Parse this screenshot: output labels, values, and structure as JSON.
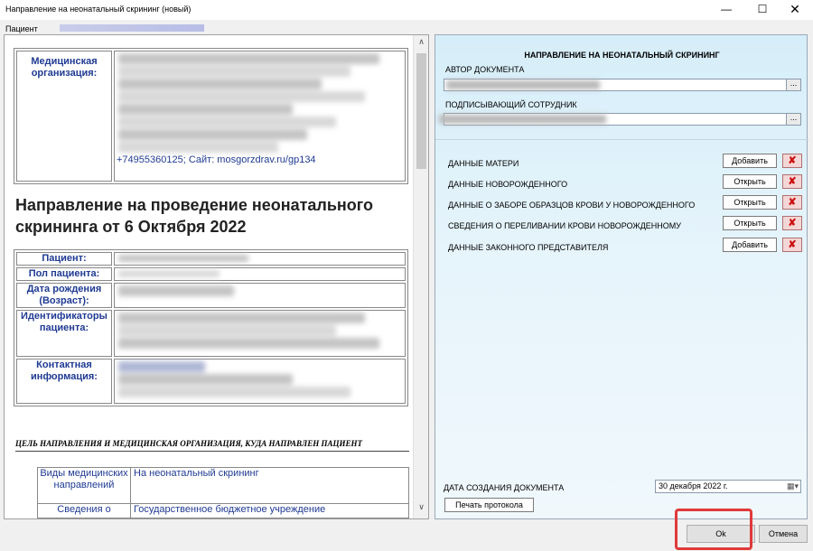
{
  "window": {
    "title": "Направление на неонатальный скрининг (новый)",
    "minimize": "—",
    "maximize": "☐",
    "close": "✕"
  },
  "patient_bar": {
    "label": "Пациент"
  },
  "document": {
    "med_org_label": "Медицинская организация:",
    "med_org_contact": "+74955360125; Сайт: mosgorzdrav.ru/gp134",
    "heading": "Направление на проведение неонатального скрининга от 6 Октября 2022",
    "patient_rows": [
      {
        "label": "Пациент:"
      },
      {
        "label": "Пол пациента:"
      },
      {
        "label": "Дата рождения (Возраст):"
      },
      {
        "label": "Идентификаторы пациента:"
      },
      {
        "label": "Контактная информация:"
      }
    ],
    "section_heading": "ЦЕЛЬ НАПРАВЛЕНИЯ И МЕДИЦИНСКАЯ ОРГАНИЗАЦИЯ, КУДА НАПРАВЛЕН ПАЦИЕНТ",
    "direction_rows": [
      {
        "key": "Виды медицинских направлений",
        "value": "На неонатальный скрининг"
      },
      {
        "key": "Сведения о",
        "value": "Государственное бюджетное учреждение"
      }
    ]
  },
  "form": {
    "title": "НАПРАВЛЕНИЕ НА НЕОНАТАЛЬНЫЙ СКРИНИНГ",
    "author_label": "АВТОР ДОКУМЕНТА",
    "signer_label": "ПОДПИСЫВАЮЩИЙ СОТРУДНИК",
    "lookup_button": "...",
    "sections": [
      {
        "label": "ДАННЫЕ МАТЕРИ",
        "button": "Добавить",
        "delete": "✘"
      },
      {
        "label": "ДАННЫЕ НОВОРОЖДЕННОГО",
        "button": "Открыть",
        "delete": "✘"
      },
      {
        "label": "ДАННЫЕ О ЗАБОРЕ ОБРАЗЦОВ КРОВИ У НОВОРОЖДЕННОГО",
        "button": "Открыть",
        "delete": "✘"
      },
      {
        "label": "СВЕДЕНИЯ О ПЕРЕЛИВАНИИ КРОВИ НОВОРОЖДЕННОМУ",
        "button": "Открыть",
        "delete": "✘"
      },
      {
        "label": "ДАННЫЕ ЗАКОННОГО ПРЕДСТАВИТЕЛЯ",
        "button": "Добавить",
        "delete": "✘"
      }
    ],
    "date_label": "ДАТА СОЗДАНИЯ ДОКУМЕНТА",
    "date_value": "30 декабря  2022 г.",
    "calendar_icon": "▦▾",
    "print_button": "Печать протокола"
  },
  "footer": {
    "ok": "Ok",
    "cancel": "Отмена"
  },
  "scroll": {
    "up": "∧",
    "down": "∨"
  },
  "colors": {
    "accent_red": "#e03a3a",
    "label_blue": "#1f3a93"
  }
}
